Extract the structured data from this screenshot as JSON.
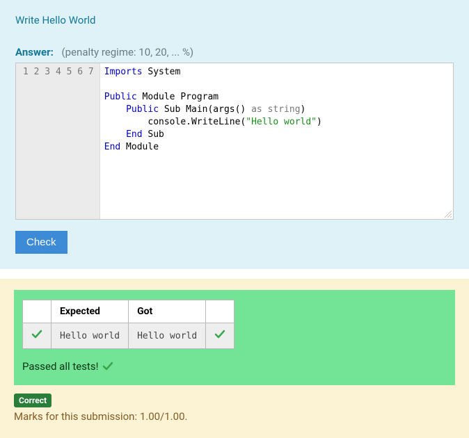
{
  "question": {
    "title": "Write Hello World",
    "answer_label": "Answer:",
    "penalty_text": "(penalty regime: 10, 20, ... %)"
  },
  "editor": {
    "line_count": 7,
    "code_tokens": [
      [
        {
          "t": "Imports",
          "c": "kw"
        },
        {
          "t": " System",
          "c": ""
        }
      ],
      [],
      [
        {
          "t": "Public",
          "c": "kw"
        },
        {
          "t": " Module",
          "c": ""
        },
        {
          "t": " Program",
          "c": ""
        }
      ],
      [
        {
          "t": "    ",
          "c": ""
        },
        {
          "t": "Public",
          "c": "kw"
        },
        {
          "t": " Sub",
          "c": ""
        },
        {
          "t": " Main(args() ",
          "c": ""
        },
        {
          "t": "as string",
          "c": "type"
        },
        {
          "t": ")",
          "c": ""
        }
      ],
      [
        {
          "t": "        console.WriteLine(",
          "c": ""
        },
        {
          "t": "\"Hello world\"",
          "c": "str"
        },
        {
          "t": ")",
          "c": ""
        }
      ],
      [
        {
          "t": "    ",
          "c": ""
        },
        {
          "t": "End",
          "c": "kw"
        },
        {
          "t": " Sub",
          "c": ""
        }
      ],
      [
        {
          "t": "End",
          "c": "kw"
        },
        {
          "t": " Module",
          "c": ""
        }
      ]
    ]
  },
  "check_button": "Check",
  "results": {
    "headers": {
      "expected": "Expected",
      "got": "Got"
    },
    "rows": [
      {
        "pass": true,
        "expected": "Hello world",
        "got": "Hello world"
      }
    ],
    "passed_text": "Passed all tests!"
  },
  "feedback": {
    "badge": "Correct",
    "marks_text": "Marks for this submission: 1.00/1.00."
  }
}
